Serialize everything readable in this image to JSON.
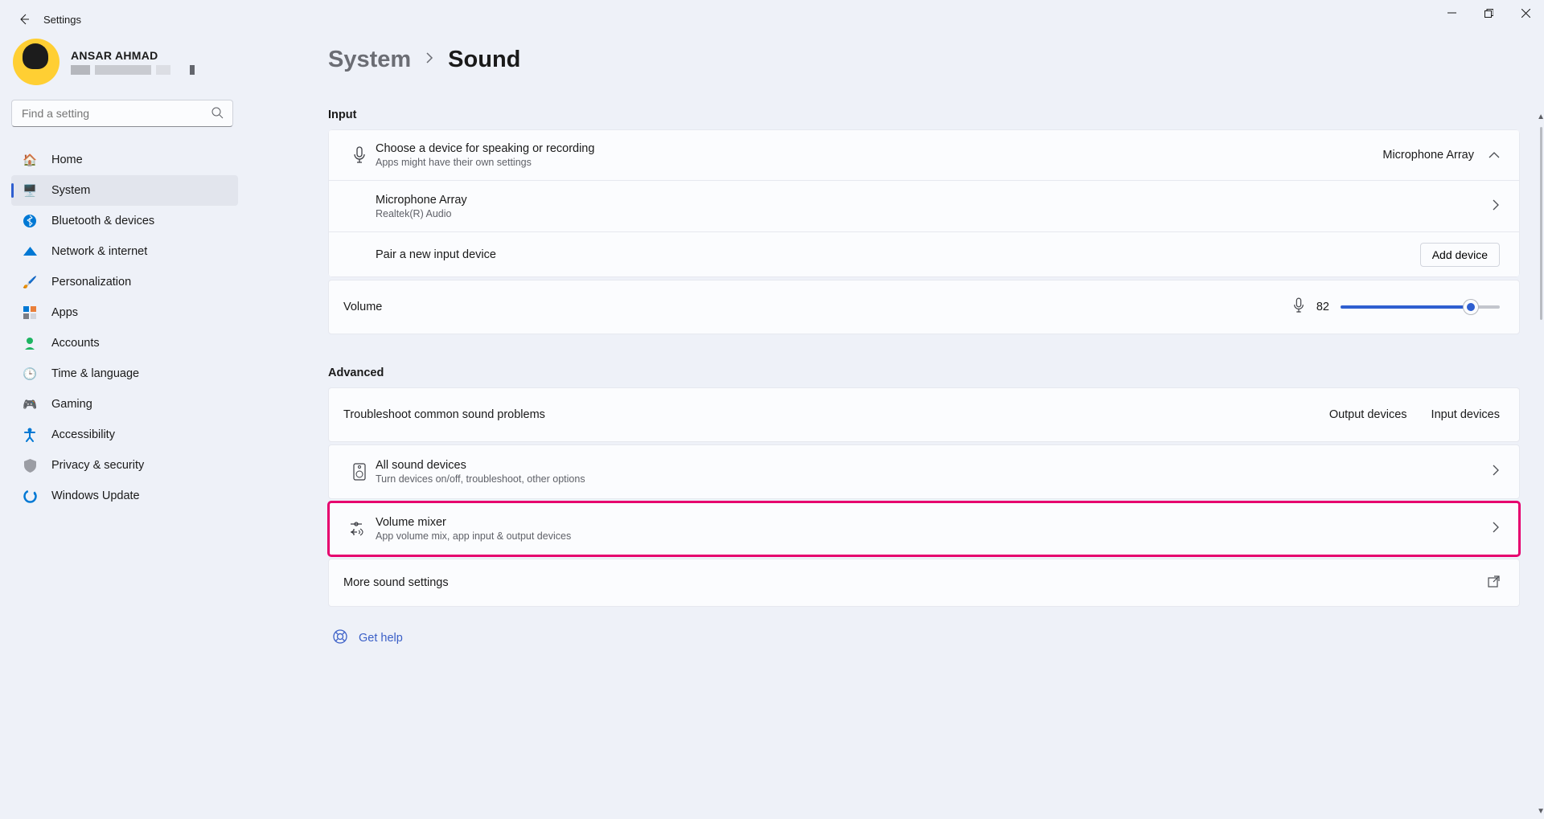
{
  "app": {
    "title": "Settings"
  },
  "user": {
    "name": "ANSAR AHMAD"
  },
  "search": {
    "placeholder": "Find a setting"
  },
  "nav": {
    "home": "Home",
    "system": "System",
    "bluetooth": "Bluetooth & devices",
    "network": "Network & internet",
    "personalization": "Personalization",
    "apps": "Apps",
    "accounts": "Accounts",
    "time": "Time & language",
    "gaming": "Gaming",
    "accessibility": "Accessibility",
    "privacy": "Privacy & security",
    "update": "Windows Update"
  },
  "breadcrumb": {
    "parent": "System",
    "current": "Sound"
  },
  "input_section": {
    "title": "Input",
    "choose": {
      "title": "Choose a device for speaking or recording",
      "sub": "Apps might have their own settings",
      "value": "Microphone Array"
    },
    "device": {
      "title": "Microphone Array",
      "sub": "Realtek(R) Audio"
    },
    "pair": {
      "title": "Pair a new input device",
      "button": "Add device"
    },
    "volume": {
      "label": "Volume",
      "value": "82"
    }
  },
  "advanced_section": {
    "title": "Advanced",
    "troubleshoot": {
      "title": "Troubleshoot common sound problems",
      "output": "Output devices",
      "input": "Input devices"
    },
    "all_devices": {
      "title": "All sound devices",
      "sub": "Turn devices on/off, troubleshoot, other options"
    },
    "mixer": {
      "title": "Volume mixer",
      "sub": "App volume mix, app input & output devices"
    },
    "more": {
      "title": "More sound settings"
    },
    "gethelp": "Get help"
  }
}
